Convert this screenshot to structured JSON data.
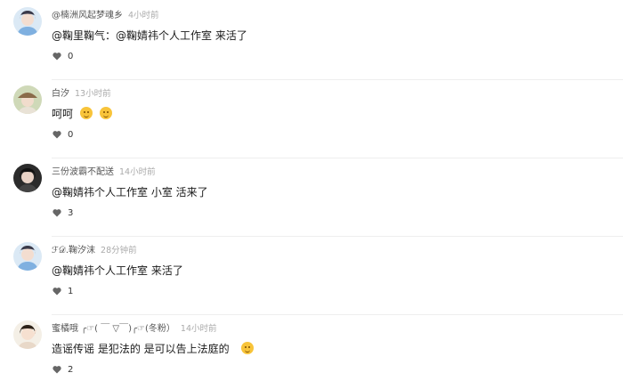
{
  "comments": [
    {
      "username": "@楠洲风起梦魂乡",
      "time": "4小时前",
      "text": "@鞠里鞠气：@鞠婧祎个人工作室 来活了",
      "emojis": 0,
      "likes": "0",
      "avatar": "girl-blue-avatar"
    },
    {
      "username": "白汐",
      "time": "13小时前",
      "text": "呵呵",
      "emojis": 2,
      "likes": "0",
      "avatar": "girl-hat-avatar"
    },
    {
      "username": "三份波霸不配送",
      "time": "14小时前",
      "text": "@鞠婧祎个人工作室  小室  活来了",
      "emojis": 0,
      "likes": "3",
      "avatar": "girl-dark-avatar"
    },
    {
      "username": "ℱ𝒟.鞠汐沫",
      "time": "28分钟前",
      "text": "@鞠婧祎个人工作室  来活了",
      "emojis": 0,
      "likes": "1",
      "avatar": "girl-blue-avatar"
    },
    {
      "username": "蜜橘哦  ╭☞( ￣ ▽￣)╭☞(冬粉）",
      "time": "14小时前",
      "text": "造谣传谣 是犯法的 是可以告上法庭的",
      "emojis": 1,
      "likes": "2",
      "avatar": "girl-peace-avatar"
    }
  ],
  "colors": {
    "username": "#555555",
    "time": "#aaaaaa",
    "heart": "#666666",
    "divider": "#eeeeee"
  }
}
